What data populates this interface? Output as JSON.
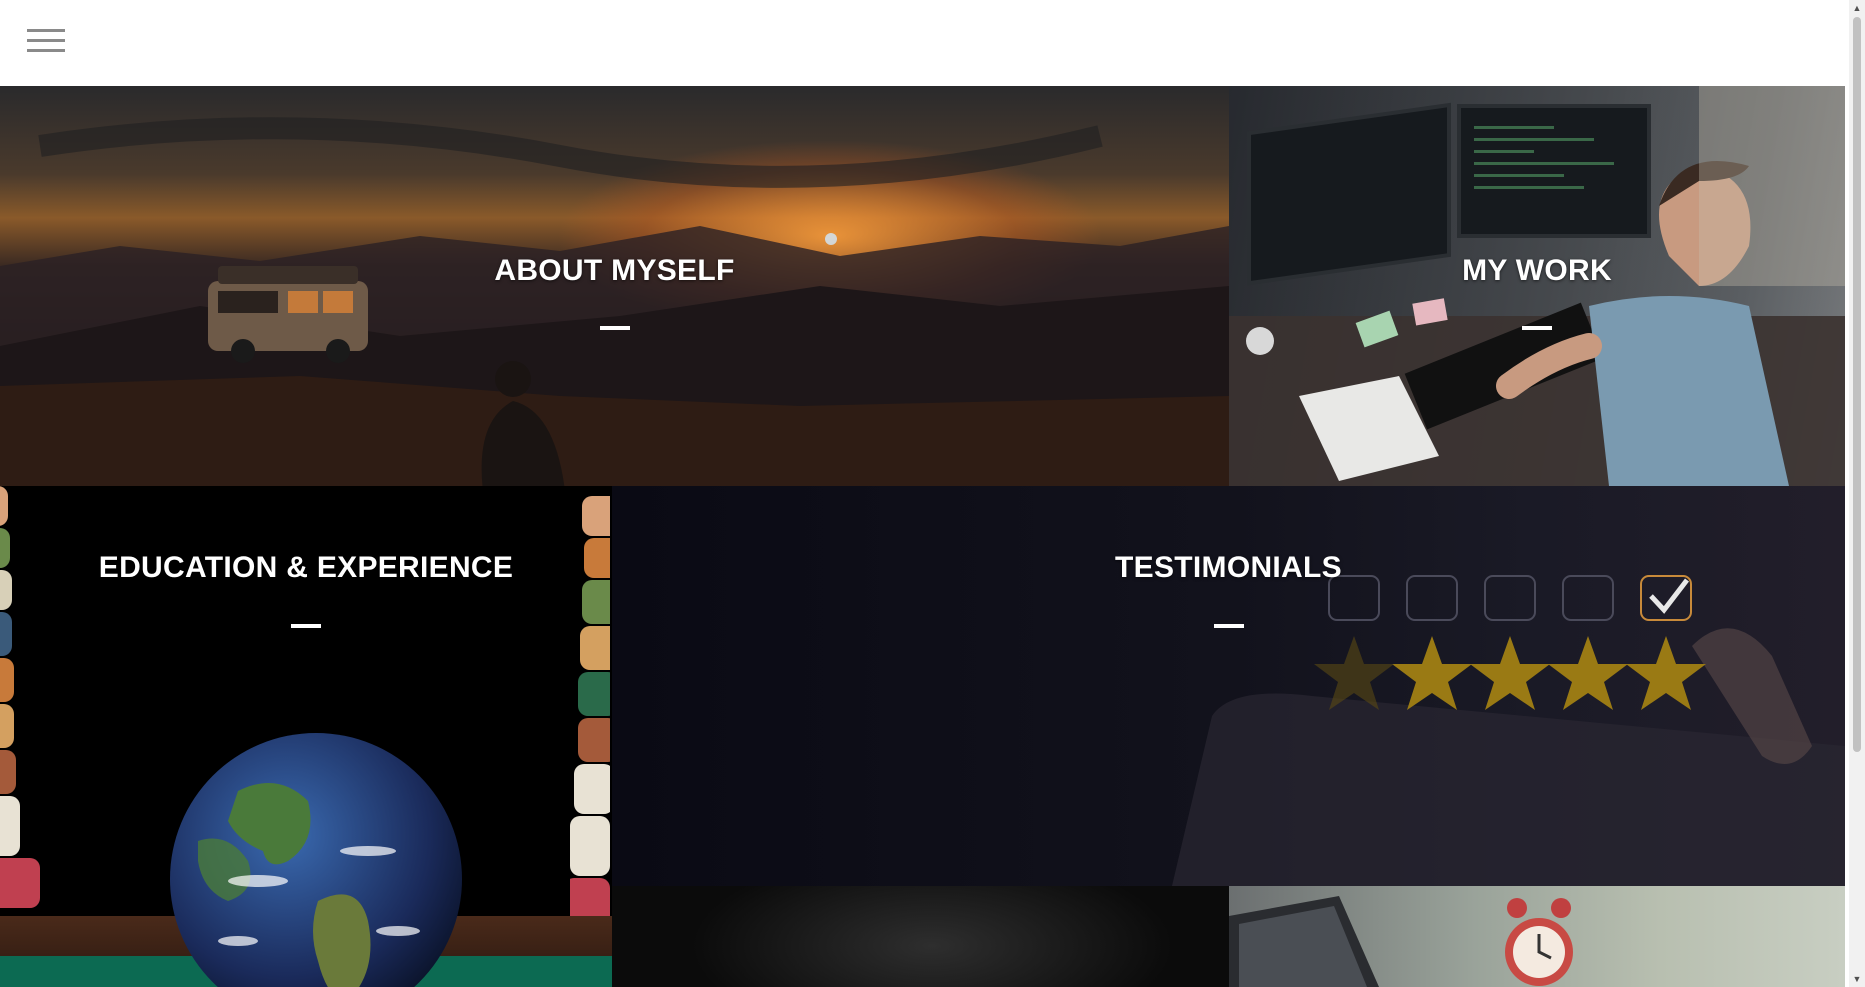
{
  "header": {
    "menu_icon": "hamburger-menu-icon"
  },
  "tiles": [
    {
      "id": "about",
      "title": "ABOUT MYSELF"
    },
    {
      "id": "work",
      "title": "MY WORK"
    },
    {
      "id": "education",
      "title": "EDUCATION & EXPERIENCE"
    },
    {
      "id": "testimonials",
      "title": "TESTIMONIALS"
    }
  ],
  "colors": {
    "title_text": "#ffffff",
    "header_bg": "#ffffff",
    "menu_icon": "#8a8a8a"
  }
}
